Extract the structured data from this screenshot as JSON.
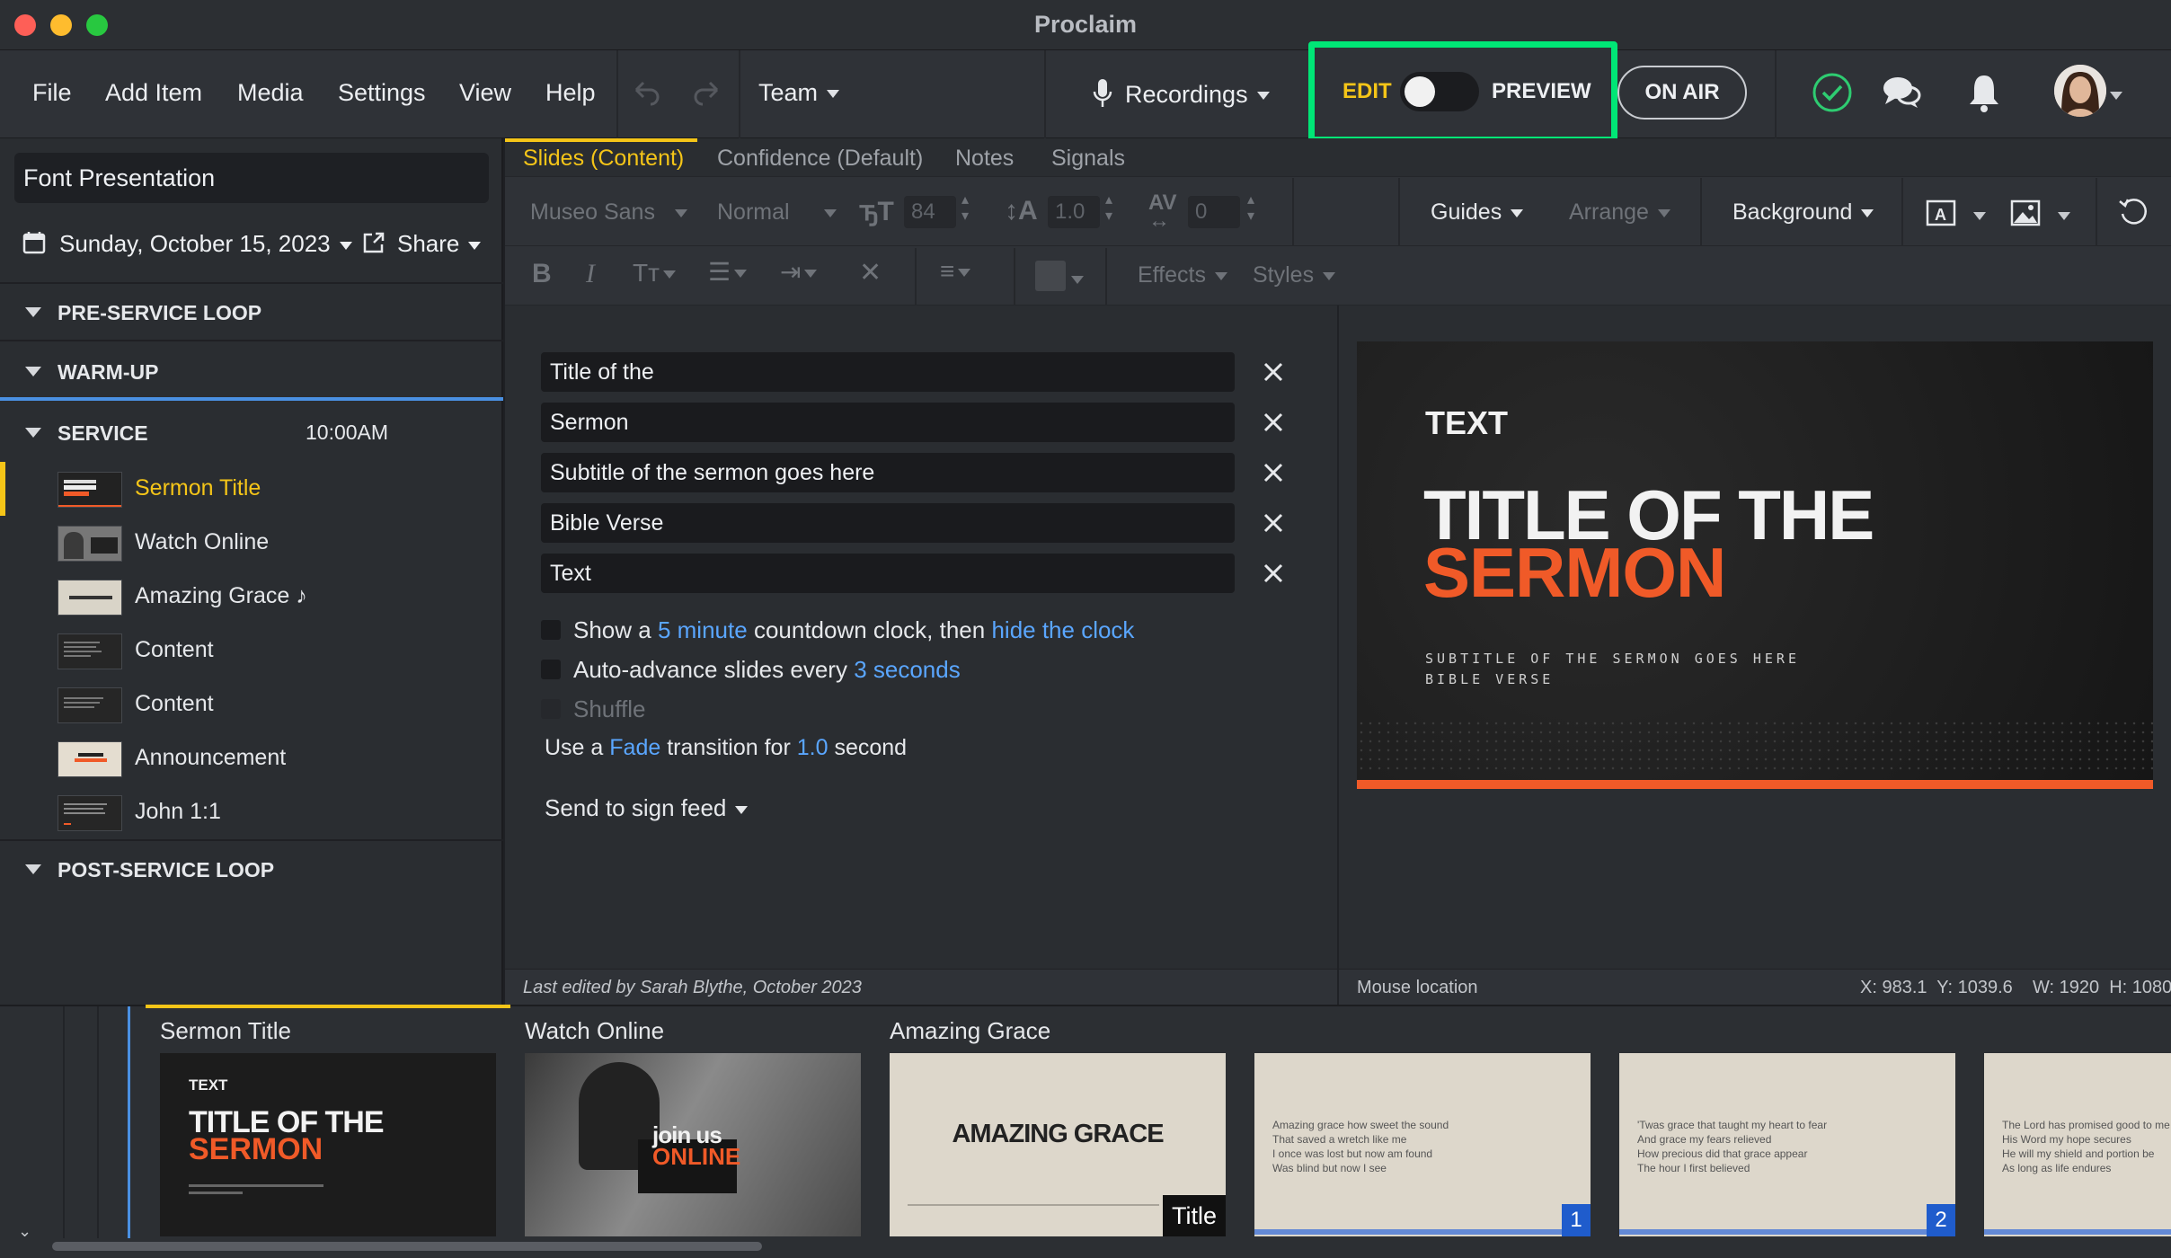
{
  "app": {
    "title": "Proclaim"
  },
  "menu": {
    "file": "File",
    "add_item": "Add Item",
    "media": "Media",
    "settings": "Settings",
    "view": "View",
    "help": "Help",
    "team": "Team",
    "recordings": "Recordings",
    "edit": "EDIT",
    "preview": "PREVIEW",
    "on_air": "ON AIR"
  },
  "sidebar": {
    "presentation_name": "Font Presentation",
    "date": "Sunday, October 15, 2023",
    "share": "Share",
    "sections": {
      "pre_service": "PRE-SERVICE LOOP",
      "warm_up": "WARM-UP",
      "service": "SERVICE",
      "service_time": "10:00AM",
      "post_service": "POST-SERVICE LOOP"
    },
    "items": [
      {
        "label": "Sermon Title",
        "selected": true
      },
      {
        "label": "Watch Online"
      },
      {
        "label": "Amazing Grace ♪"
      },
      {
        "label": "Content"
      },
      {
        "label": "Content"
      },
      {
        "label": "Announcement"
      },
      {
        "label": "John 1:1"
      }
    ]
  },
  "tabs": [
    "Slides (Content)",
    "Confidence (Default)",
    "Notes",
    "Signals"
  ],
  "toolbar": {
    "font": "Museo Sans",
    "weight": "Normal",
    "size": "84",
    "line_height": "1.0",
    "spacing": "0",
    "guides": "Guides",
    "arrange": "Arrange",
    "background": "Background",
    "effects": "Effects",
    "styles": "Styles"
  },
  "fields": [
    "Title of the",
    "Sermon",
    "Subtitle of the sermon goes here",
    "Bible Verse",
    "Text"
  ],
  "options": {
    "countdown_pre": "Show a",
    "countdown_min": "5 minute",
    "countdown_mid": "countdown clock, then",
    "countdown_end": "hide the clock",
    "auto_pre": "Auto-advance slides every",
    "auto_val": "3 seconds",
    "shuffle": "Shuffle",
    "trans_pre": "Use a",
    "trans_type": "Fade",
    "trans_mid": "transition for",
    "trans_val": "1.0",
    "trans_end": "second",
    "sign_feed": "Send to sign feed"
  },
  "slide_preview": {
    "small": "TEXT",
    "title1": "TITLE OF THE",
    "title2": "SERMON",
    "sub1": "SUBTITLE OF THE SERMON GOES HERE",
    "sub2": "BIBLE VERSE"
  },
  "status": {
    "last_edited": "Last edited by Sarah Blythe, October 2023",
    "mouse": "Mouse location",
    "coords": "X: 983.1  Y: 1039.6    W: 1920  H: 1080"
  },
  "bottom": {
    "labels": [
      "Sermon Title",
      "Watch Online",
      "Amazing Grace"
    ],
    "thumb1": {
      "small": "TEXT",
      "t1": "TITLE OF THE",
      "t2": "SERMON"
    },
    "thumb2": {
      "t1": "join us",
      "t2": "ONLINE"
    },
    "thumb3": {
      "t": "AMAZING GRACE",
      "tag": "Title"
    },
    "thumb4": {
      "lines": "Amazing grace how sweet the sound\nThat saved a wretch like me\nI once was lost but now am found\nWas blind but now I see",
      "num": "1"
    },
    "thumb5": {
      "lines": "'Twas grace that taught my heart to fear\nAnd grace my fears relieved\nHow precious did that grace appear\nThe hour I first believed",
      "num": "2"
    },
    "thumb6": {
      "lines": "The Lord has promised good to me\nHis Word my hope secures\nHe will my shield and portion be\nAs long as life endures"
    }
  },
  "colors": {
    "accent_yellow": "#f5c518",
    "highlight_green": "#00e676",
    "link_blue": "#5aa6ff",
    "orange": "#f05a28"
  }
}
